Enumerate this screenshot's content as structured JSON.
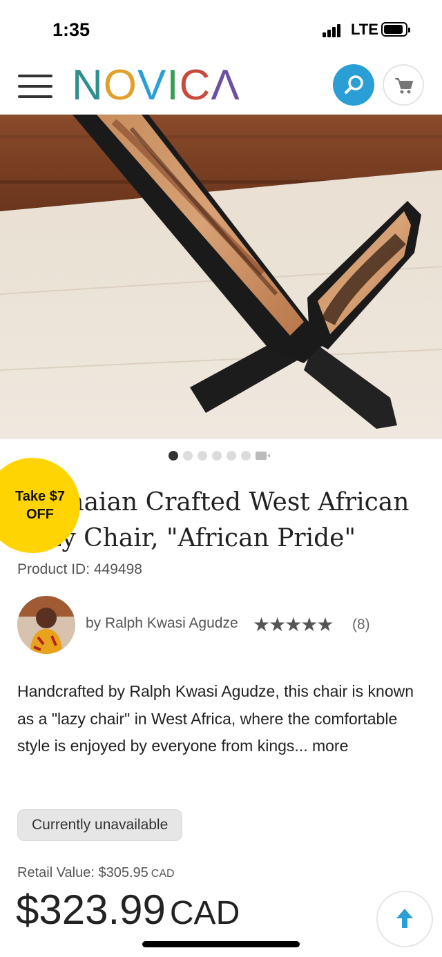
{
  "status_bar": {
    "time": "1:35",
    "network": "LTE"
  },
  "header": {
    "logo_letters": [
      "N",
      "O",
      "V",
      "I",
      "C",
      "Λ"
    ],
    "logo_colors": [
      "#2e8f8c",
      "#e2a028",
      "#2a9fd6",
      "#3a9c56",
      "#c84a3c",
      "#6b4fa0"
    ],
    "accent_color": "#2a9fd6",
    "icons": {
      "menu": "hamburger-menu-icon",
      "search": "search-icon",
      "cart": "cart-icon"
    }
  },
  "carousel": {
    "total_images": 6,
    "active_index": 0,
    "has_video": true
  },
  "promo": {
    "line1": "Take $7",
    "line2": "OFF",
    "color": "#ffd400"
  },
  "product": {
    "title_line1": "Ghanaian Crafted West African",
    "title_line2": "Lazy Chair, \"African Pride\"",
    "product_id": "Product ID: 449498"
  },
  "artist": {
    "by_text": "by Ralph Kwasi Agudze",
    "rating_stars": "★★★★★",
    "rating": 5,
    "review_count": "(8)"
  },
  "description": {
    "text": "Handcrafted by Ralph Kwasi Agudze, this chair is known as a \"lazy chair\" in West Africa, where the comfortable style is enjoyed by everyone from kings...",
    "more_label": "more"
  },
  "availability": {
    "label": "Currently unavailable"
  },
  "pricing": {
    "retail_label": "Retail Value: $305.95",
    "retail_currency": "CAD",
    "price": "$323.99",
    "currency": "CAD"
  },
  "back_to_top": {
    "icon": "arrow-up-icon"
  }
}
